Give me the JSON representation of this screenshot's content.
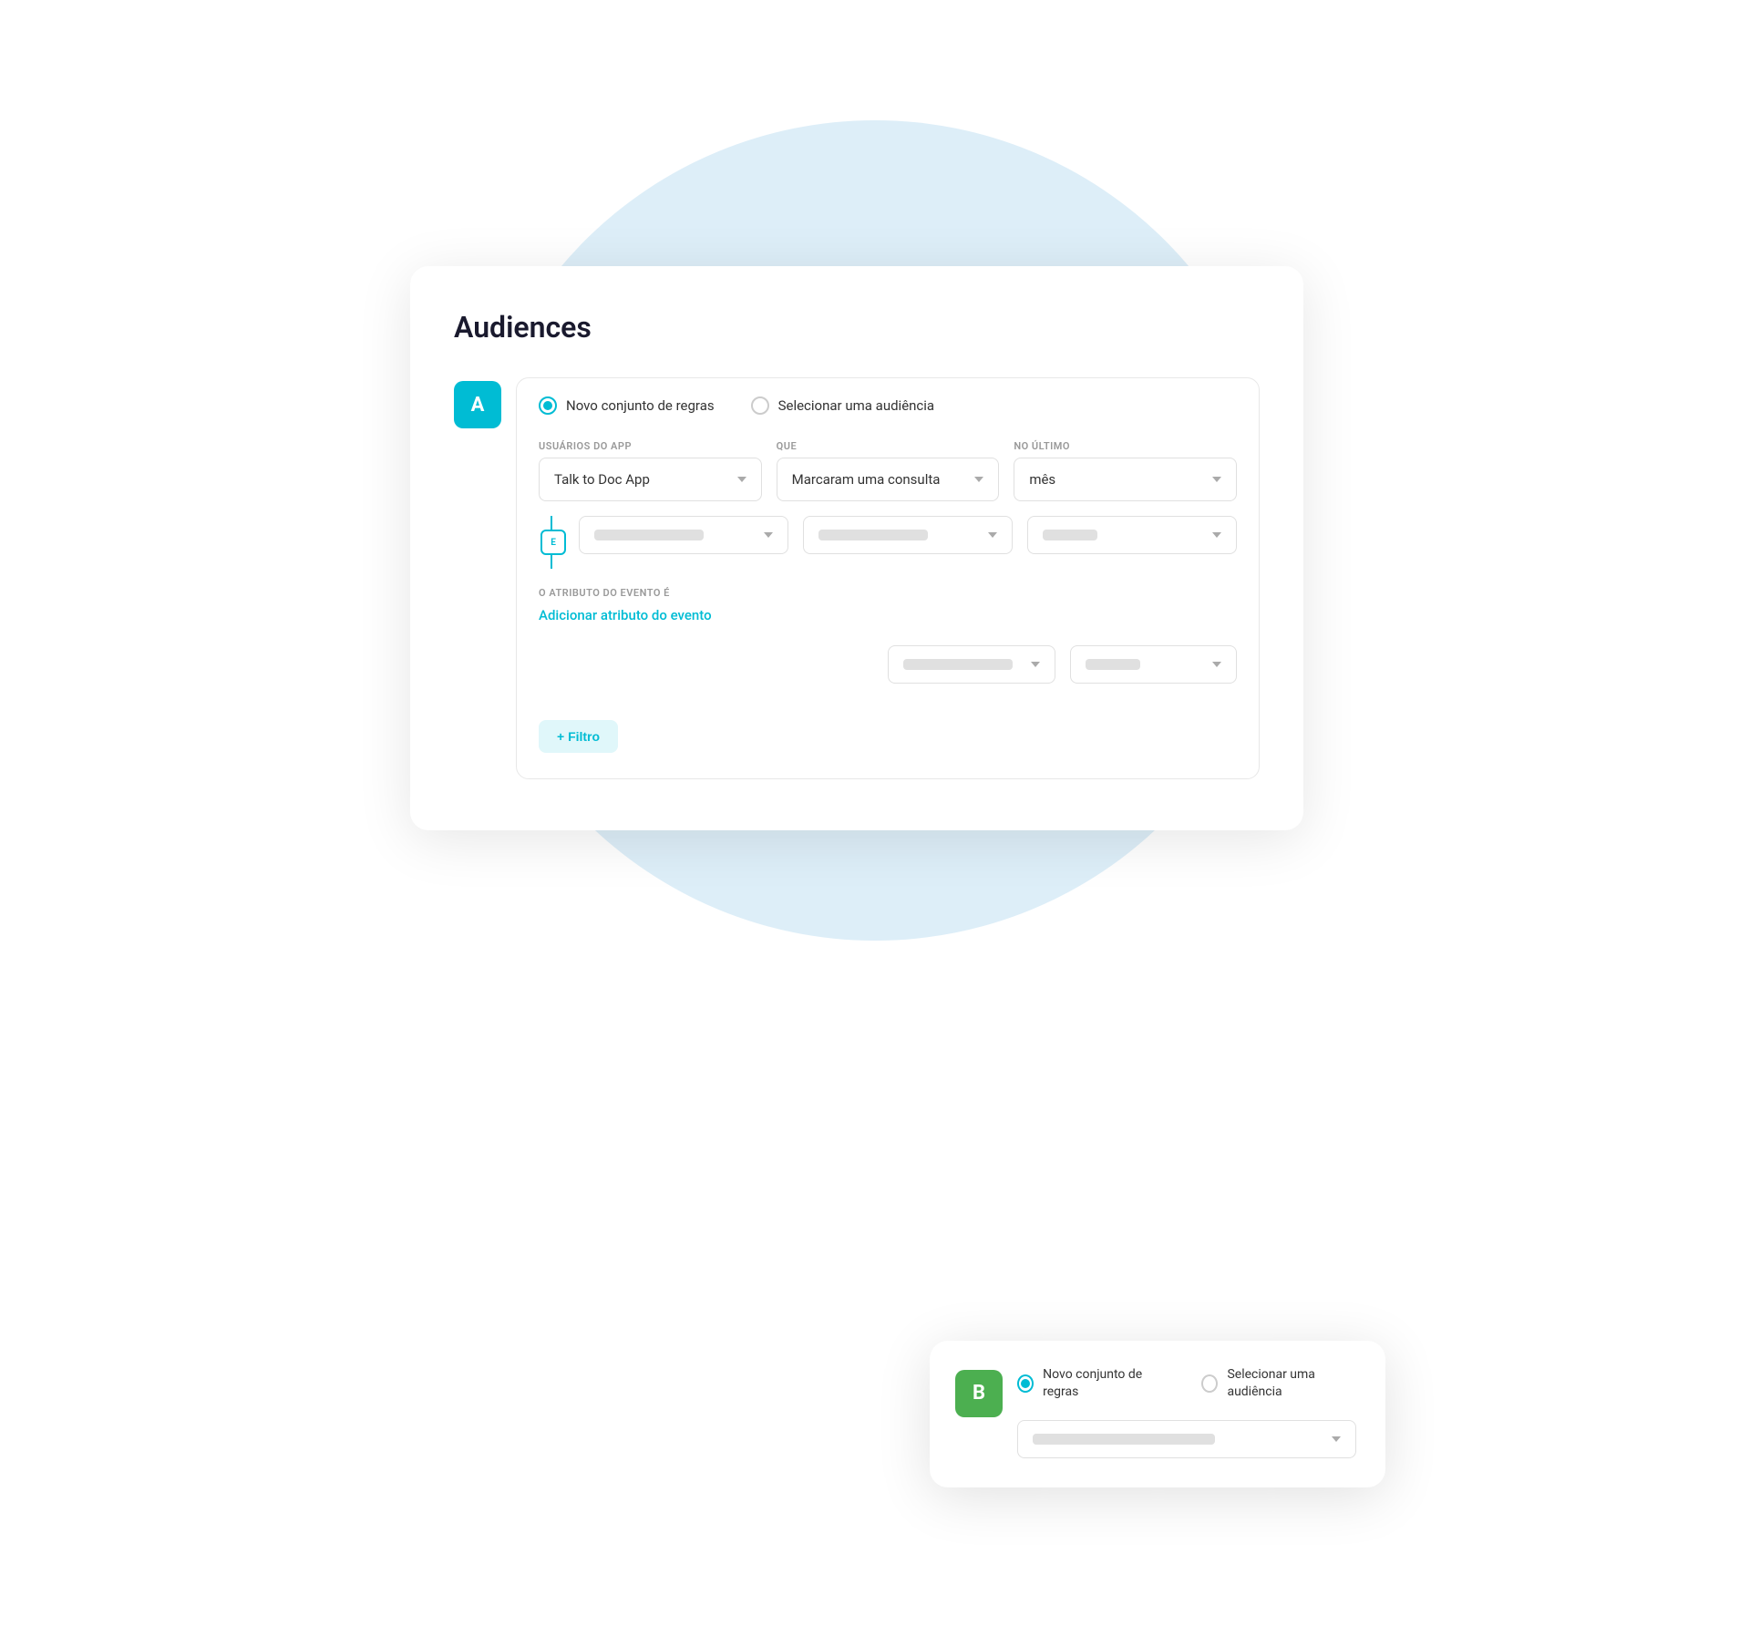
{
  "page": {
    "title": "Audiences"
  },
  "audience_a": {
    "label": "A",
    "radio_option_1": "Novo conjunto de regras",
    "radio_option_2": "Selecionar uma audiência",
    "filter1": {
      "col1_label": "USUÁRIOS DO APP",
      "col1_value": "Talk to Doc App",
      "col2_label": "QUE",
      "col2_value": "Marcaram uma consulta",
      "col3_label": "NO ÚLTIMO",
      "col3_value": "mês"
    },
    "and_badge": "E",
    "event_attr_label": "O ATRIBUTO DO EVENTO É",
    "add_event_link": "Adicionar atributo do evento",
    "add_filter_label": "+ Filtro"
  },
  "audience_b": {
    "label": "B",
    "radio_option_1": "Novo conjunto de regras",
    "radio_option_2": "Selecionar uma audiência"
  }
}
